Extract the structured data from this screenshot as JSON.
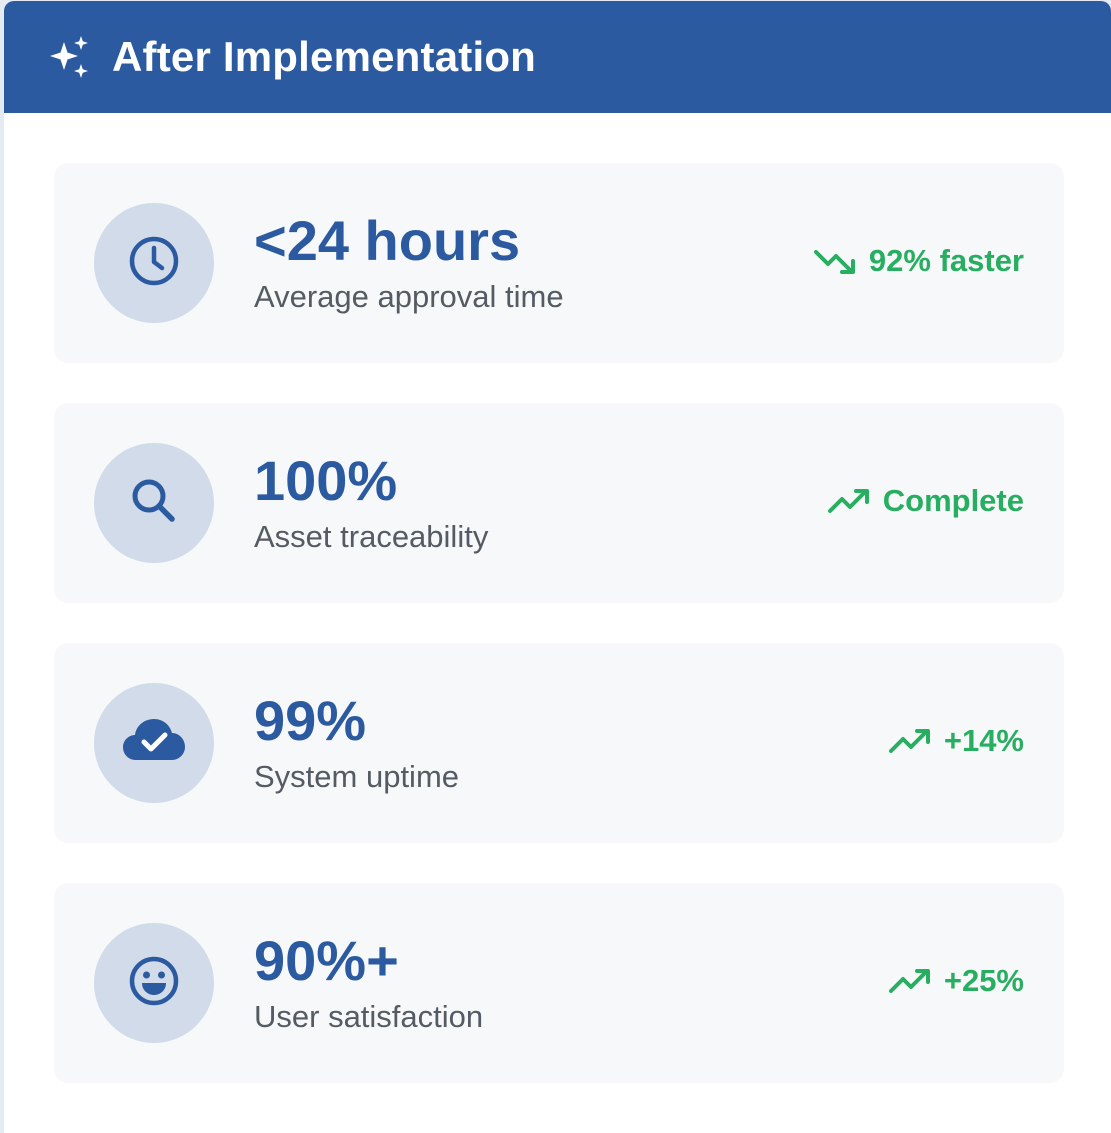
{
  "header": {
    "title": "After Implementation",
    "icon": "sparkles-icon"
  },
  "metrics": [
    {
      "icon": "clock-icon",
      "value": "<24 hours",
      "label": "Average approval time",
      "trend_icon": "trend-down-icon",
      "trend": "92% faster"
    },
    {
      "icon": "search-icon",
      "value": "100%",
      "label": "Asset traceability",
      "trend_icon": "trend-up-icon",
      "trend": "Complete"
    },
    {
      "icon": "cloud-check-icon",
      "value": "99%",
      "label": "System uptime",
      "trend_icon": "trend-up-icon",
      "trend": "+14%"
    },
    {
      "icon": "smile-icon",
      "value": "90%+",
      "label": "User satisfaction",
      "trend_icon": "trend-up-icon",
      "trend": "+25%"
    }
  ],
  "colors": {
    "header_bg": "#2c5aa0",
    "value_text": "#2c5aa0",
    "trend_green": "#27ae60",
    "icon_circle": "#d1dbe9",
    "row_bg": "#f6f8fa"
  }
}
